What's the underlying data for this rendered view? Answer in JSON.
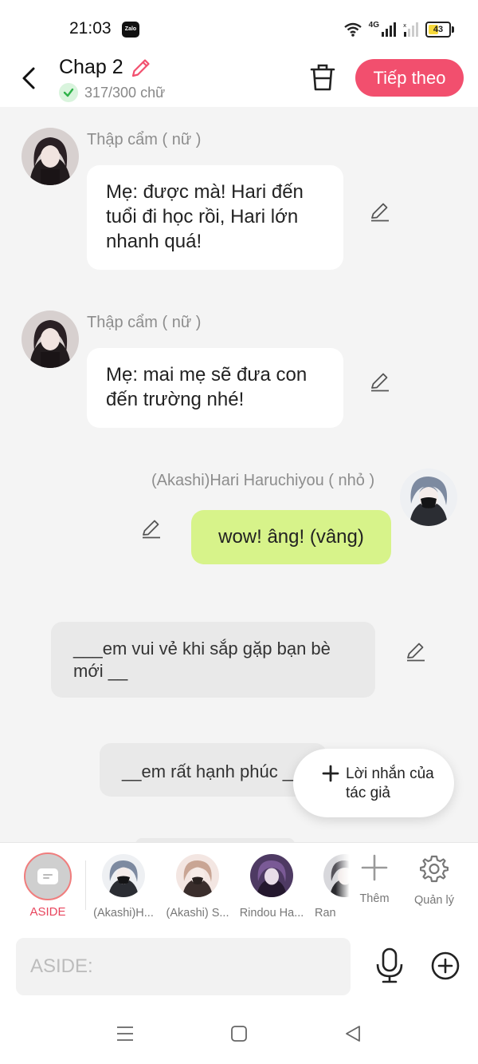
{
  "status_bar": {
    "time": "21:03",
    "zalo_label": "Zalo",
    "network_label": "4G",
    "battery": "43"
  },
  "header": {
    "title": "Chap 2",
    "word_count": "317/300 chữ",
    "next_button": "Tiếp theo",
    "accent_color": "#f24f6e"
  },
  "messages": [
    {
      "speaker": "Thập cẩm ( nữ )",
      "text": "Mẹ: được mà! Hari đến tuổi đi học rồi, Hari lớn nhanh quá!",
      "side": "left"
    },
    {
      "speaker": "Thập cẩm ( nữ )",
      "text": "Mẹ: mai mẹ sẽ đưa con đến trường nhé!",
      "side": "left"
    },
    {
      "speaker": "(Akashi)Hari Haruchiyou ( nhỏ )",
      "text": "wow! âng! (vâng)",
      "side": "right"
    },
    {
      "text": "___em vui vẻ khi sắp gặp bạn bè mới __",
      "side": "aside"
    },
    {
      "text": "__em rất hạnh phúc __",
      "side": "aside"
    }
  ],
  "author_note": {
    "label": "Lời nhắn của tác giả"
  },
  "character_bar": {
    "aside_label": "ASIDE",
    "characters": [
      {
        "name": "(Akashi)H..."
      },
      {
        "name": "(Akashi) S..."
      },
      {
        "name": "Rindou Ha..."
      },
      {
        "name": "Ran"
      }
    ],
    "more_label": "Thêm",
    "manage_label": "Quản lý"
  },
  "input": {
    "placeholder": "ASIDE:"
  },
  "icons": [
    "zalo-icon",
    "wifi-icon",
    "signal-icon",
    "battery-icon",
    "back-icon",
    "pencil-icon",
    "check-icon",
    "trash-icon",
    "plus-icon",
    "gear-icon",
    "mic-icon",
    "add-circle-icon",
    "menu-icon",
    "home-icon",
    "back-triangle-icon"
  ]
}
